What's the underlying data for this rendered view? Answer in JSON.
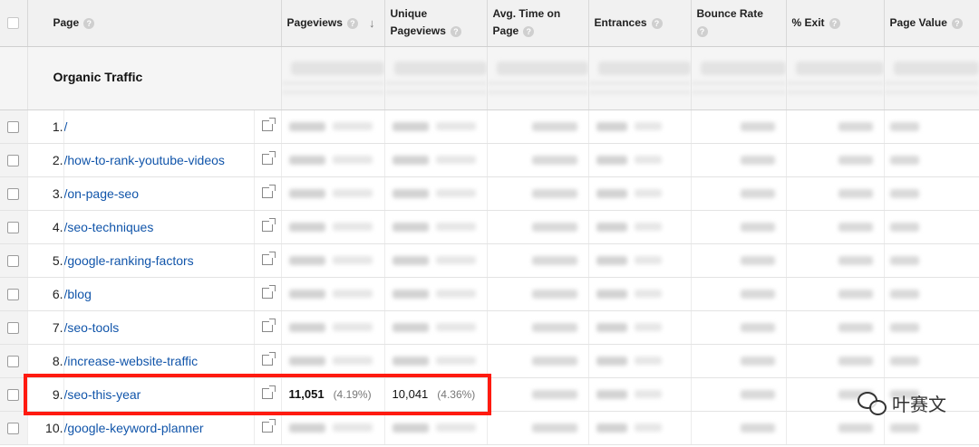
{
  "columns": {
    "page": "Page",
    "pageviews": "Pageviews",
    "unique_line1": "Unique",
    "unique_line2": "Pageviews",
    "avg_line1": "Avg. Time on",
    "avg_line2": "Page",
    "entrances": "Entrances",
    "bounce": "Bounce Rate",
    "exit": "% Exit",
    "page_value": "Page Value"
  },
  "icons": {
    "help": "question-mark-circle-icon",
    "sort": "arrow-down-icon",
    "popout": "external-window-icon",
    "watermark": "wechat-icon"
  },
  "section_title": "Organic Traffic",
  "rows": [
    {
      "num": "1.",
      "page": "/"
    },
    {
      "num": "2.",
      "page": "/how-to-rank-youtube-videos"
    },
    {
      "num": "3.",
      "page": "/on-page-seo"
    },
    {
      "num": "4.",
      "page": "/seo-techniques"
    },
    {
      "num": "5.",
      "page": "/google-ranking-factors"
    },
    {
      "num": "6.",
      "page": "/blog"
    },
    {
      "num": "7.",
      "page": "/seo-tools"
    },
    {
      "num": "8.",
      "page": "/increase-website-traffic"
    },
    {
      "num": "9.",
      "page": "/seo-this-year",
      "pageviews": "11,051",
      "pageviews_pct": "(4.19%)",
      "unique": "10,041",
      "unique_pct": "(4.36%)"
    },
    {
      "num": "10.",
      "page": "/google-keyword-planner"
    }
  ],
  "watermark_text": "叶赛文",
  "colors": {
    "highlight": "#ff1a10",
    "link": "#1155aa",
    "header_bg": "#f1f1f1"
  }
}
